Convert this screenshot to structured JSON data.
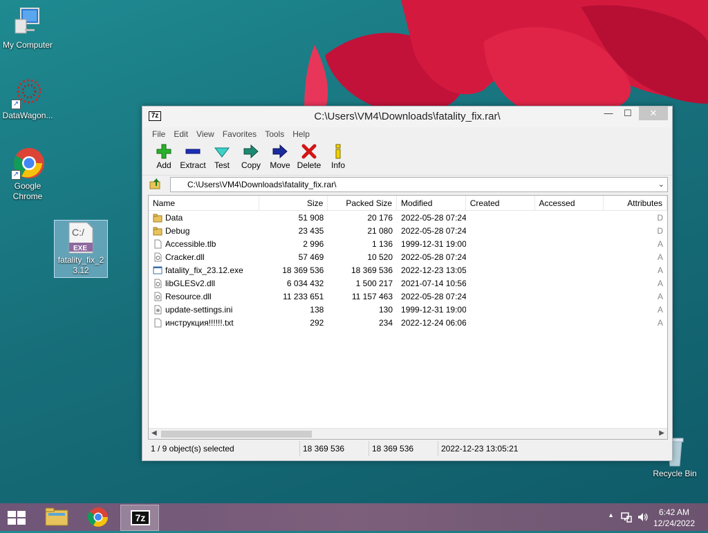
{
  "desktop": {
    "icons": [
      {
        "label": "My Computer"
      },
      {
        "label": "DataWagon..."
      },
      {
        "label": "Google Chrome"
      },
      {
        "label": "fatality_fix_23.12",
        "badge": "EXE",
        "glyph": "C:/"
      },
      {
        "label": "Recycle Bin"
      }
    ]
  },
  "window": {
    "title": "C:\\Users\\VM4\\Downloads\\fatality_fix.rar\\",
    "app_icon": "7z",
    "menu": [
      "File",
      "Edit",
      "View",
      "Favorites",
      "Tools",
      "Help"
    ],
    "toolbar": {
      "add": "Add",
      "extract": "Extract",
      "test": "Test",
      "copy": "Copy",
      "move": "Move",
      "delete": "Delete",
      "info": "Info"
    },
    "address": "C:\\Users\\VM4\\Downloads\\fatality_fix.rar\\",
    "columns": {
      "name": "Name",
      "size": "Size",
      "packed": "Packed Size",
      "modified": "Modified",
      "created": "Created",
      "accessed": "Accessed",
      "attributes": "Attributes"
    },
    "files": [
      {
        "name": "Data",
        "size": "51 908",
        "packed": "20 176",
        "modified": "2022-05-28 07:24",
        "attr": "D",
        "type": "folder"
      },
      {
        "name": "Debug",
        "size": "23 435",
        "packed": "21 080",
        "modified": "2022-05-28 07:24",
        "attr": "D",
        "type": "folder"
      },
      {
        "name": "Accessible.tlb",
        "size": "2 996",
        "packed": "1 136",
        "modified": "1999-12-31 19:00",
        "attr": "A",
        "type": "file"
      },
      {
        "name": "Cracker.dll",
        "size": "57 469",
        "packed": "10 520",
        "modified": "2022-05-28 07:24",
        "attr": "A",
        "type": "dll"
      },
      {
        "name": "fatality_fix_23.12.exe",
        "size": "18 369 536",
        "packed": "18 369 536",
        "modified": "2022-12-23 13:05",
        "attr": "A",
        "type": "exe"
      },
      {
        "name": "libGLESv2.dll",
        "size": "6 034 432",
        "packed": "1 500 217",
        "modified": "2021-07-14 10:56",
        "attr": "A",
        "type": "dll"
      },
      {
        "name": "Resource.dll",
        "size": "11 233 651",
        "packed": "11 157 463",
        "modified": "2022-05-28 07:24",
        "attr": "A",
        "type": "dll"
      },
      {
        "name": "update-settings.ini",
        "size": "138",
        "packed": "130",
        "modified": "1999-12-31 19:00",
        "attr": "A",
        "type": "ini"
      },
      {
        "name": "инструкция!!!!!!.txt",
        "size": "292",
        "packed": "234",
        "modified": "2022-12-24 06:06",
        "attr": "A",
        "type": "file"
      }
    ],
    "status": {
      "selection": "1 / 9 object(s) selected",
      "size": "18 369 536",
      "packed": "18 369 536",
      "modified": "2022-12-23 13:05:21"
    }
  },
  "taskbar": {
    "clock_time": "6:42 AM",
    "clock_date": "12/24/2022",
    "seven_zip_label": "7z"
  },
  "colors": {
    "accent_selected": "#cce8ff",
    "taskbar": "#7c5f7b"
  }
}
